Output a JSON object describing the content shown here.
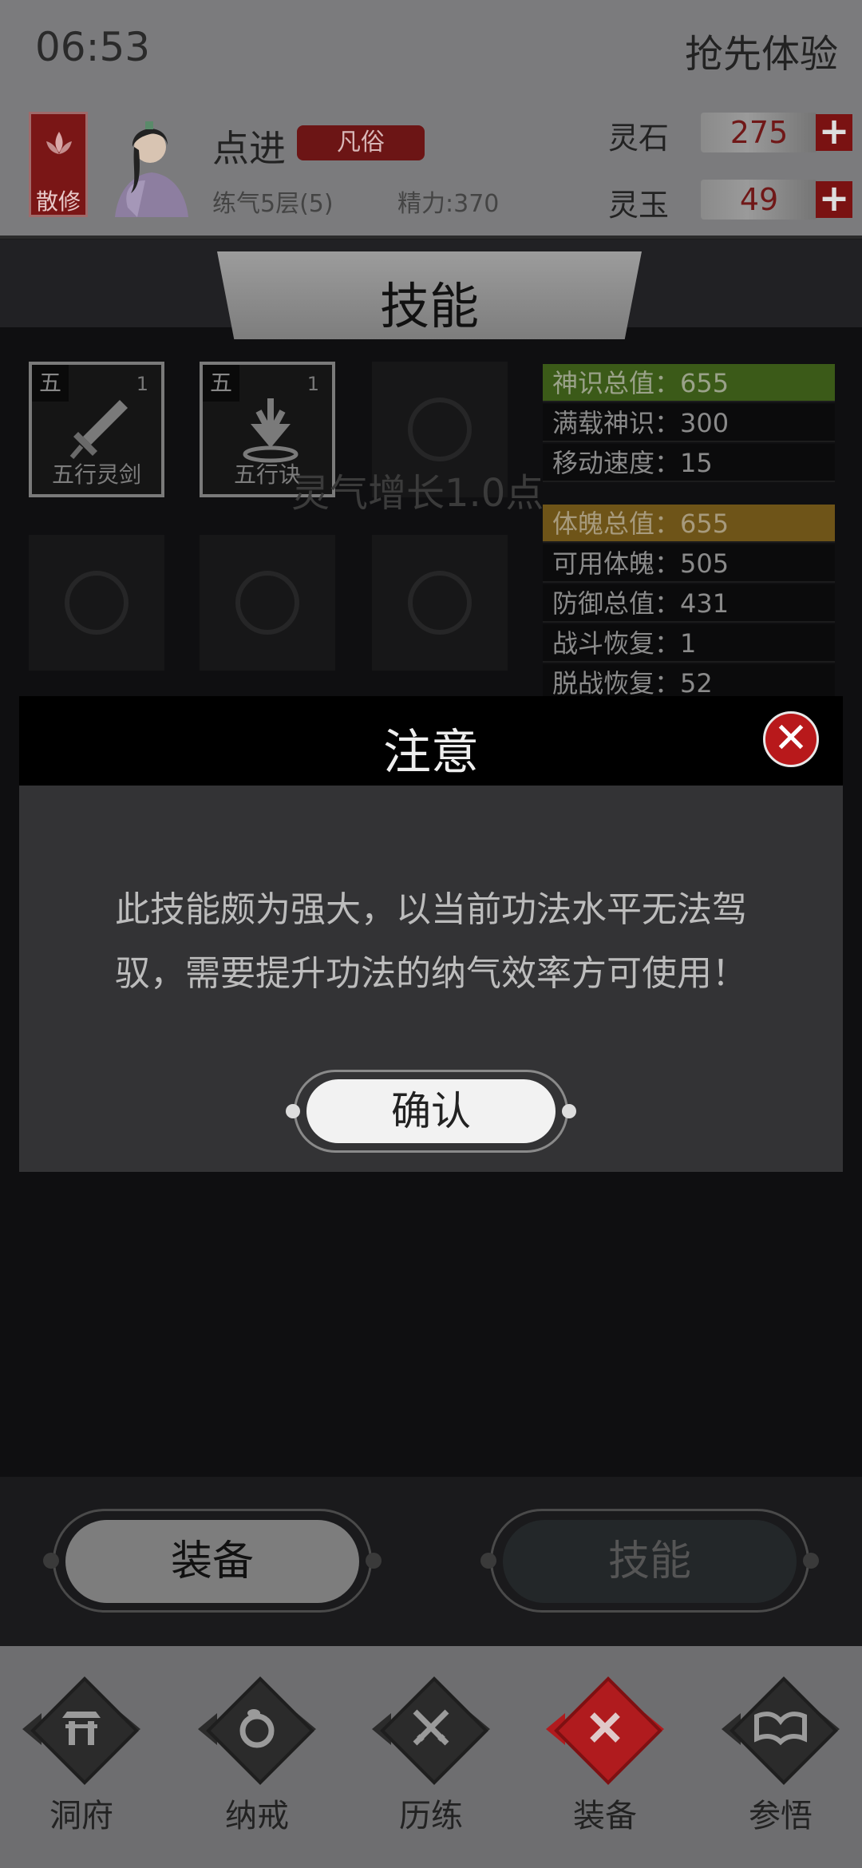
{
  "status": {
    "time": "06:53",
    "early_access": "抢先体验"
  },
  "player": {
    "sect": "散修",
    "name": "点进",
    "realm": "凡俗",
    "cultivation": "练气5层(5)",
    "energy": "精力:370"
  },
  "currency": {
    "spirit_stone_label": "灵石",
    "spirit_stone_value": "275",
    "spirit_jade_label": "灵玉",
    "spirit_jade_value": "49",
    "add_symbol": "+"
  },
  "panel": {
    "title": "技能"
  },
  "skills": [
    {
      "element": "五",
      "level": "1",
      "name": "五行灵剑"
    },
    {
      "element": "五",
      "level": "1",
      "name": "五行诀"
    }
  ],
  "float_text": "灵气增长1.0点",
  "stats": [
    {
      "label": "神识总值：655"
    },
    {
      "label": "满载神识：300"
    },
    {
      "label": "移动速度：15"
    },
    {
      "label": "体魄总值：655"
    },
    {
      "label": "可用体魄：505"
    },
    {
      "label": "防御总值：431"
    },
    {
      "label": "战斗恢复：1"
    },
    {
      "label": "脱战恢复：52"
    }
  ],
  "dialog": {
    "title": "注意",
    "line1": "此技能颇为强大，以当前功法水平无法驾",
    "line2": "驭，需要提升功法的纳气效率方可使用！",
    "confirm": "确认",
    "close": "✕"
  },
  "bottom_tabs": {
    "equip": "装备",
    "skills": "技能"
  },
  "nav": [
    {
      "label": "洞府",
      "icon": "cave-dwelling-icon"
    },
    {
      "label": "纳戒",
      "icon": "storage-ring-icon"
    },
    {
      "label": "历练",
      "icon": "crossed-swords-icon"
    },
    {
      "label": "装备",
      "icon": "equipment-close-icon"
    },
    {
      "label": "参悟",
      "icon": "open-book-icon"
    }
  ],
  "colors": {
    "accent_red": "#b01b1e",
    "dialog_bg": "#333335",
    "stat_green": "#3b5a18",
    "stat_orange": "#6e5418"
  }
}
